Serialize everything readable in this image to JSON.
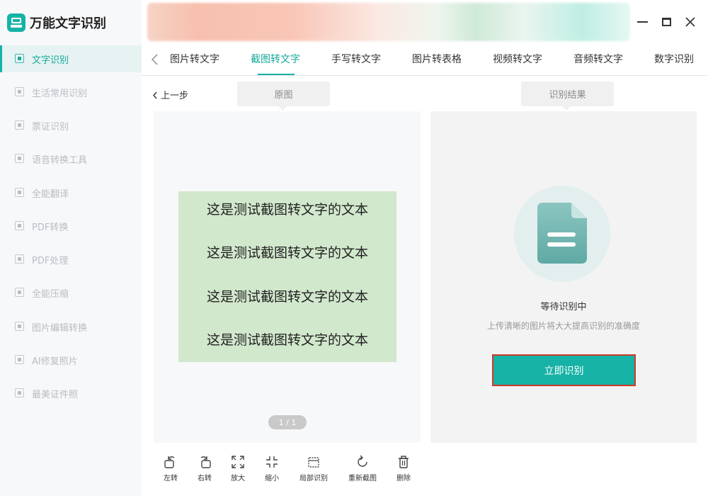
{
  "app": {
    "title": "万能文字识别"
  },
  "sidebar": {
    "items": [
      {
        "label": "文字识别",
        "active": true
      },
      {
        "label": "生活常用识别"
      },
      {
        "label": "票证识别"
      },
      {
        "label": "语音转换工具"
      },
      {
        "label": "全能翻译"
      },
      {
        "label": "PDF转换"
      },
      {
        "label": "PDF处理"
      },
      {
        "label": "全能压缩"
      },
      {
        "label": "图片编辑转换"
      },
      {
        "label": "AI修复照片"
      },
      {
        "label": "最美证件照"
      }
    ]
  },
  "tabs": [
    {
      "label": "图片转文字"
    },
    {
      "label": "截图转文字",
      "active": true
    },
    {
      "label": "手写转文字"
    },
    {
      "label": "图片转表格"
    },
    {
      "label": "视频转文字"
    },
    {
      "label": "音频转文字"
    },
    {
      "label": "数字识别"
    }
  ],
  "content": {
    "back_label": "上一步",
    "original_label": "原图",
    "result_label": "识别结果",
    "doc_lines": [
      "这是测试截图转文字的文本",
      "这是测试截图转文字的文本",
      "这是测试截图转文字的文本",
      "这是测试截图转文字的文本"
    ],
    "pager": "1 / 1",
    "status_title": "等待识别中",
    "status_sub": "上传清晰的图片将大大提高识别的准确度",
    "recognize_button": "立即识别"
  },
  "toolbar": {
    "rotate_left": "左转",
    "rotate_right": "右转",
    "zoom_in": "放大",
    "zoom_out": "缩小",
    "partial_recognize": "局部识别",
    "recapture": "重新截图",
    "delete": "删除"
  },
  "colors": {
    "accent": "#17b2a6",
    "button_border": "#d23a2a",
    "doc_background": "#d1e8cc"
  }
}
